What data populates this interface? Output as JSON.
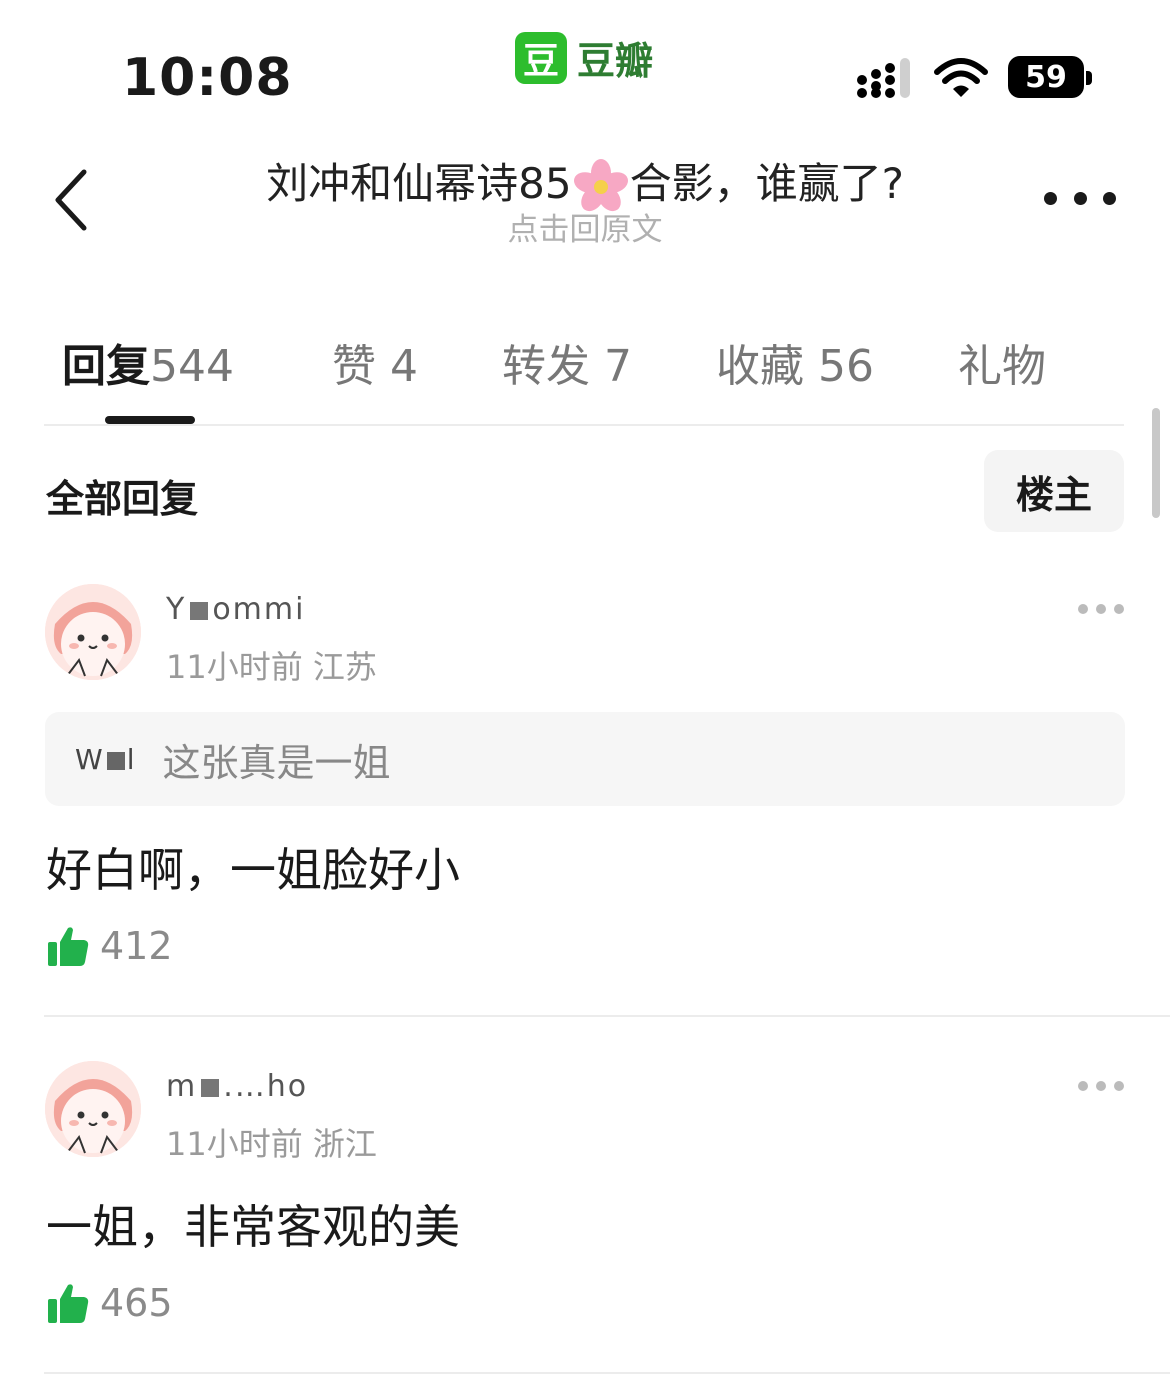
{
  "status_bar": {
    "time": "10:08",
    "app_logo_char": "豆",
    "app_name": "豆瓣",
    "battery": "59",
    "signal_icon": "cellular-signal-icon",
    "wifi_icon": "wifi-icon"
  },
  "header": {
    "title_before": "刘冲和仙幂诗85",
    "title_emoji": "🌸",
    "title_after": "合影，谁赢了?",
    "subtitle": "点击回原文"
  },
  "tabs": [
    {
      "label": "回复",
      "count": "544",
      "active": true
    },
    {
      "label": "赞",
      "count": "4",
      "active": false
    },
    {
      "label": "转发",
      "count": "7",
      "active": false
    },
    {
      "label": "收藏",
      "count": "56",
      "active": false
    },
    {
      "label": "礼物",
      "count": "",
      "active": false
    }
  ],
  "section": {
    "title": "全部回复",
    "filter_button": "楼主"
  },
  "comments": [
    {
      "username_start": "Y",
      "username_end": "ommi",
      "time": "11小时前",
      "location": "江苏",
      "quote_user_start": "W",
      "quote_user_end": "l",
      "quote_text": "这张真是一姐",
      "content": "好白啊，一姐脸好小",
      "likes": "412"
    },
    {
      "username_start": "m",
      "username_end": ".…ho",
      "time": "11小时前",
      "location": "浙江",
      "content": "一姐，非常客观的美",
      "likes": "465"
    }
  ],
  "colors": {
    "brand_green": "#2dbd2d",
    "like_green": "#22b14c",
    "text_primary": "#1a1a1a",
    "text_secondary": "#9a9a9a"
  }
}
